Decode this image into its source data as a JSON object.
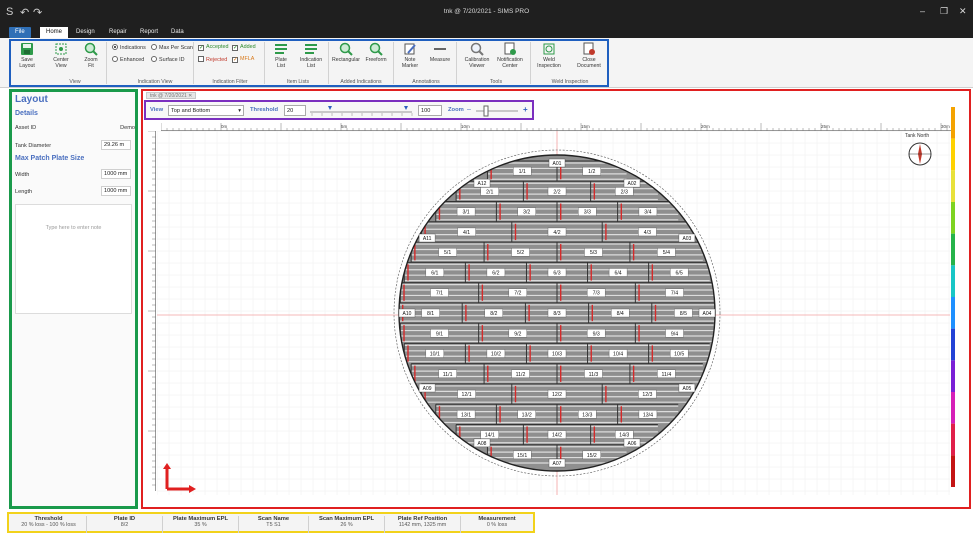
{
  "window": {
    "title": "tnk @ 7/20/2021 - SIMS PRO",
    "logo": "S",
    "quick_access": [
      "↶",
      "↷"
    ],
    "minimize": "–",
    "restore": "❐",
    "close": "✕"
  },
  "tabs": [
    "File",
    "Home",
    "Design",
    "Repair",
    "Report",
    "Data"
  ],
  "ribbon": {
    "view": {
      "save_layout": "Save\nLayout",
      "center_view": "Center\nView",
      "zoom_fit": "Zoom\nFit",
      "group_label": "View"
    },
    "indication_view": {
      "indications": "Indications",
      "max_per_scan": "Max Per Scan",
      "enhanced": "Enhanced",
      "surface_id": "Surface ID",
      "group_label": "Indication View"
    },
    "indication_filter": {
      "accepted": "Accepted",
      "added": "Added",
      "rejected": "Rejected",
      "mfla": "MFLA",
      "group_label": "Indication Filter"
    },
    "item_lists": {
      "plate_list": "Plate\nList",
      "indication_list": "Indication\nList",
      "group_label": "Item Lists"
    },
    "added_indications": {
      "rectangular": "Rectangular",
      "freeform": "Freeform",
      "group_label": "Added Indications"
    },
    "annotations": {
      "note_marker": "Note\nMarker",
      "measure": "Measure",
      "group_label": "Annotations"
    },
    "tools": {
      "calibration_viewer": "Calibration\nViewer",
      "notification_center": "Notification\nCenter",
      "group_label": "Tools"
    },
    "weld_inspection": {
      "weld_inspection": "Weld\nInspection",
      "close_document": "Close\nDocument",
      "group_label": "Weld Inspection"
    }
  },
  "left_panel": {
    "title": "Layout",
    "details_header": "Details",
    "asset_id_label": "Asset ID",
    "asset_id_value": "Demo",
    "tank_diameter_label": "Tank Diameter",
    "tank_diameter_value": "29.26 m",
    "patch_header": "Max Patch Plate Size",
    "width_label": "Width",
    "width_value": "1000 mm",
    "length_label": "Length",
    "length_value": "1000 mm",
    "note_placeholder": "Type here to enter note"
  },
  "canvas": {
    "doc_tab": "tnk @ 7/20/2021",
    "view_label": "View",
    "view_value": "Top and Bottom",
    "threshold_label": "Threshold",
    "threshold_min": "20",
    "threshold_max": "100",
    "zoom_label": "Zoom",
    "zoom_minus": "–",
    "zoom_plus": "+",
    "compass_label": "Tank North",
    "ruler_labels": [
      "0m",
      "5m",
      "10m",
      "15m",
      "20m",
      "25m",
      "30m"
    ],
    "edge_labels": [
      "A01",
      "A02",
      "A03",
      "A04",
      "A05",
      "A06",
      "A07",
      "A08",
      "A09",
      "A10",
      "A11",
      "A12"
    ],
    "rows": [
      [
        "1/1",
        "1/2"
      ],
      [
        "2/1",
        "2/2",
        "2/3"
      ],
      [
        "3/1",
        "3/2",
        "3/3",
        "3/4"
      ],
      [
        "4/1",
        "4/2",
        "4/3"
      ],
      [
        "5/1",
        "5/2",
        "5/3",
        "5/4"
      ],
      [
        "6/1",
        "6/2",
        "6/3",
        "6/4",
        "6/5"
      ],
      [
        "7/1",
        "7/2",
        "7/3",
        "7/4"
      ],
      [
        "8/1",
        "8/2",
        "8/3",
        "8/4",
        "8/5"
      ],
      [
        "9/1",
        "9/2",
        "9/3",
        "9/4"
      ],
      [
        "10/1",
        "10/2",
        "10/3",
        "10/4",
        "10/5"
      ],
      [
        "11/1",
        "11/2",
        "11/3",
        "11/4"
      ],
      [
        "12/1",
        "12/2",
        "12/3"
      ],
      [
        "13/1",
        "13/2",
        "13/3",
        "13/4"
      ],
      [
        "14/1",
        "14/2",
        "14/3"
      ],
      [
        "15/1",
        "15/2"
      ]
    ]
  },
  "status_bar": [
    {
      "header": "Threshold",
      "value": "20 % loss - 100 % loss"
    },
    {
      "header": "Plate ID",
      "value": "8/2"
    },
    {
      "header": "Plate Maximum EPL",
      "value": "35 %"
    },
    {
      "header": "Scan Name",
      "value": "T5 S1"
    },
    {
      "header": "Scan Maximum EPL",
      "value": "26 %"
    },
    {
      "header": "Plate Ref Position",
      "value": "1142 mm, 1325 mm"
    },
    {
      "header": "Measurement",
      "value": "0 % loss"
    }
  ]
}
